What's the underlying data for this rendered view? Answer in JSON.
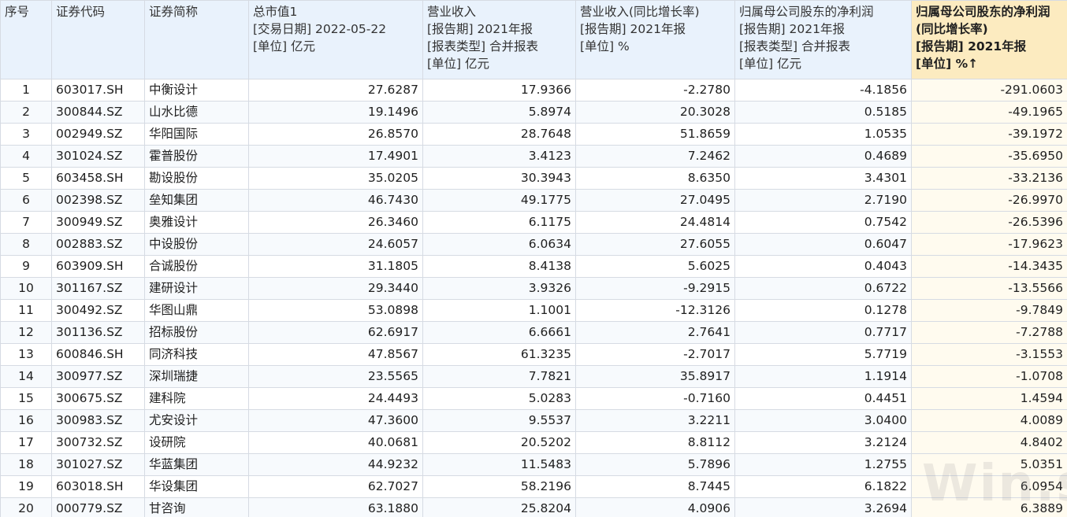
{
  "table": {
    "headers": [
      {
        "key": "idx",
        "lines": [
          "序号"
        ]
      },
      {
        "key": "code",
        "lines": [
          "证券代码"
        ]
      },
      {
        "key": "name",
        "lines": [
          "证券简称"
        ]
      },
      {
        "key": "mcap",
        "lines": [
          "总市值1",
          "[交易日期] 2022-05-22",
          "[单位] 亿元"
        ]
      },
      {
        "key": "rev",
        "lines": [
          "营业收入",
          "[报告期] 2021年报",
          "[报表类型] 合并报表",
          "[单位] 亿元"
        ]
      },
      {
        "key": "revg",
        "lines": [
          "营业收入(同比增长率)",
          "[报告期] 2021年报",
          "[单位] %"
        ]
      },
      {
        "key": "np",
        "lines": [
          "归属母公司股东的净利润",
          "[报告期] 2021年报",
          "[报表类型] 合并报表",
          "[单位] 亿元"
        ]
      },
      {
        "key": "npg",
        "lines": [
          "归属母公司股东的净利润",
          "(同比增长率)",
          "[报告期] 2021年报",
          "[单位] %↑"
        ],
        "sorted": true
      }
    ],
    "rows": [
      [
        "1",
        "603017.SH",
        "中衡设计",
        "27.6287",
        "17.9366",
        "-2.2780",
        "-4.1856",
        "-291.0603"
      ],
      [
        "2",
        "300844.SZ",
        "山水比德",
        "19.1496",
        "5.8974",
        "20.3028",
        "0.5185",
        "-49.1965"
      ],
      [
        "3",
        "002949.SZ",
        "华阳国际",
        "26.8570",
        "28.7648",
        "51.8659",
        "1.0535",
        "-39.1972"
      ],
      [
        "4",
        "301024.SZ",
        "霍普股份",
        "17.4901",
        "3.4123",
        "7.2462",
        "0.4689",
        "-35.6950"
      ],
      [
        "5",
        "603458.SH",
        "勘设股份",
        "35.0205",
        "30.3943",
        "8.6350",
        "3.4301",
        "-33.2136"
      ],
      [
        "6",
        "002398.SZ",
        "垒知集团",
        "46.7430",
        "49.1775",
        "27.0495",
        "2.7190",
        "-26.9970"
      ],
      [
        "7",
        "300949.SZ",
        "奥雅设计",
        "26.3460",
        "6.1175",
        "24.4814",
        "0.7542",
        "-26.5396"
      ],
      [
        "8",
        "002883.SZ",
        "中设股份",
        "24.6057",
        "6.0634",
        "27.6055",
        "0.6047",
        "-17.9623"
      ],
      [
        "9",
        "603909.SH",
        "合诚股份",
        "31.1805",
        "8.4138",
        "5.6025",
        "0.4043",
        "-14.3435"
      ],
      [
        "10",
        "301167.SZ",
        "建研设计",
        "29.3440",
        "3.9326",
        "-9.2915",
        "0.6722",
        "-13.5566"
      ],
      [
        "11",
        "300492.SZ",
        "华图山鼎",
        "53.0898",
        "1.1001",
        "-12.3126",
        "0.1278",
        "-9.7849"
      ],
      [
        "12",
        "301136.SZ",
        "招标股份",
        "62.6917",
        "6.6661",
        "2.7641",
        "0.7717",
        "-7.2788"
      ],
      [
        "13",
        "600846.SH",
        "同济科技",
        "47.8567",
        "61.3235",
        "-2.7017",
        "5.7719",
        "-3.1553"
      ],
      [
        "14",
        "300977.SZ",
        "深圳瑞捷",
        "23.5565",
        "7.7821",
        "35.8917",
        "1.1914",
        "-1.0708"
      ],
      [
        "15",
        "300675.SZ",
        "建科院",
        "24.4493",
        "5.0283",
        "-0.7160",
        "0.4451",
        "1.4594"
      ],
      [
        "16",
        "300983.SZ",
        "尤安设计",
        "47.3600",
        "9.5537",
        "3.2211",
        "3.0400",
        "4.0089"
      ],
      [
        "17",
        "300732.SZ",
        "设研院",
        "40.0681",
        "20.5202",
        "8.8112",
        "3.2124",
        "4.8402"
      ],
      [
        "18",
        "301027.SZ",
        "华蓝集团",
        "44.9232",
        "11.5483",
        "5.7896",
        "1.2755",
        "5.0351"
      ],
      [
        "19",
        "603018.SH",
        "华设集团",
        "62.7027",
        "58.2196",
        "8.7445",
        "6.1822",
        "6.0954"
      ],
      [
        "20",
        "000779.SZ",
        "甘咨询",
        "63.1880",
        "25.8204",
        "4.0906",
        "3.2694",
        "6.3889"
      ]
    ]
  },
  "watermark": "Win.s",
  "colors": {
    "header_bg": "#e9f2fc",
    "sorted_header_bg": "#fcebc0",
    "grid_line": "#d6dbe3"
  }
}
